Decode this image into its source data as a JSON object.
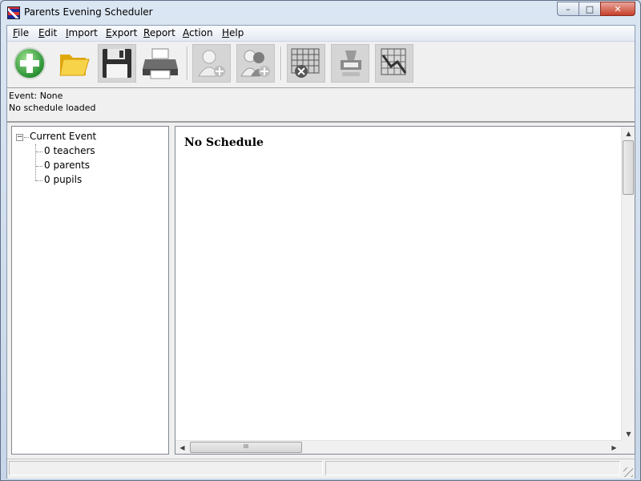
{
  "window": {
    "title": "Parents Evening Scheduler",
    "controls": {
      "minimize": "–",
      "maximize": "□",
      "close": "✕"
    }
  },
  "menu": {
    "items": [
      {
        "label_u": "F",
        "label_rest": "ile"
      },
      {
        "label_u": "E",
        "label_rest": "dit"
      },
      {
        "label_u": "I",
        "label_rest": "mport"
      },
      {
        "label_u": "E",
        "label_rest": "xport"
      },
      {
        "label_u": "R",
        "label_rest": "eport"
      },
      {
        "label_u": "A",
        "label_rest": "ction"
      },
      {
        "label_u": "H",
        "label_rest": "elp"
      }
    ]
  },
  "toolbar": {
    "buttons": [
      {
        "icon": "add-icon",
        "enabled": true
      },
      {
        "icon": "open-folder-icon",
        "enabled": true
      },
      {
        "icon": "save-disk-icon",
        "enabled": true
      },
      {
        "icon": "printer-icon",
        "enabled": true
      },
      {
        "icon": "add-teacher-icon",
        "enabled": false
      },
      {
        "icon": "add-parents-icon",
        "enabled": false
      },
      {
        "icon": "clear-schedule-icon",
        "enabled": false
      },
      {
        "icon": "stamp-icon",
        "enabled": false
      },
      {
        "icon": "chart-icon",
        "enabled": false
      }
    ]
  },
  "info": {
    "event": "Event: None",
    "schedule_status": "No schedule loaded"
  },
  "tree": {
    "root": "Current Event",
    "children": [
      "0 teachers",
      "0 parents",
      "0 pupils"
    ],
    "toggle": "−"
  },
  "schedule": {
    "title": "No Schedule",
    "scroll_glyph": "III"
  },
  "colors": {
    "add_green": "#3cb043",
    "folder_yellow": "#f4c21c",
    "close_red": "#c7402a"
  }
}
